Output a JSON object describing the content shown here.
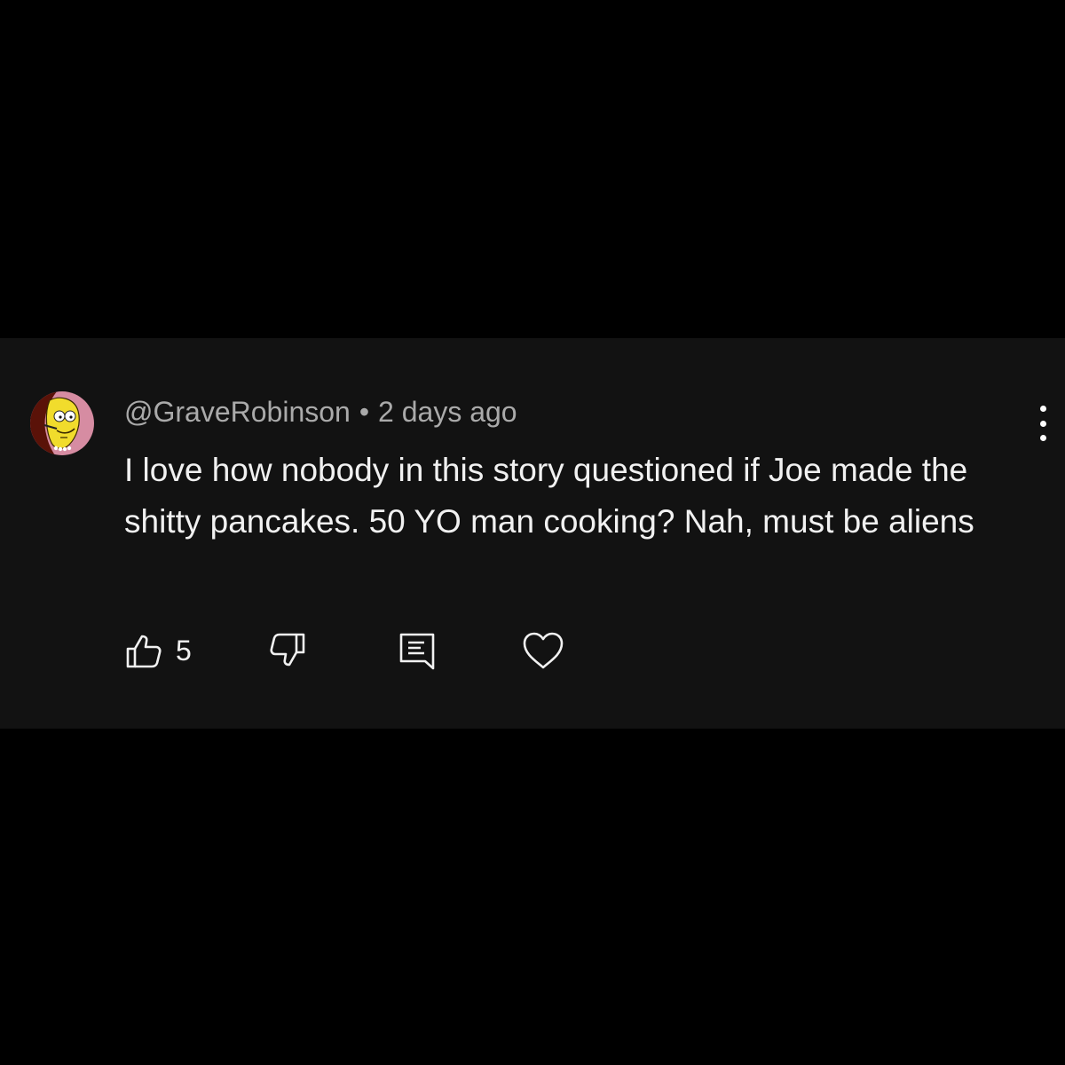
{
  "comment": {
    "username": "@GraveRobinson",
    "separator": "•",
    "time_ago": "2 days ago",
    "text": "I love how nobody in this story questioned if Joe made the shitty pancakes. 50 YO man cooking? Nah, must be aliens",
    "like_count": "5"
  },
  "colors": {
    "page_background": "#000000",
    "card_background": "#121212",
    "meta_text": "#aaaaaa",
    "body_text": "#f1f1f1"
  },
  "icons": {
    "like": "thumbs-up-icon",
    "dislike": "thumbs-down-icon",
    "reply": "reply-comment-icon",
    "heart": "heart-icon",
    "more": "more-vertical-icon"
  }
}
